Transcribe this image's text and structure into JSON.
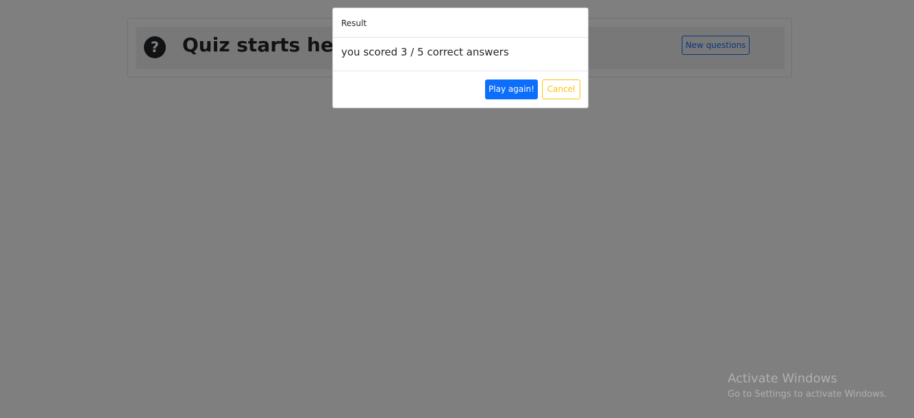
{
  "page": {
    "title": "Quiz starts here",
    "help_icon": "question-circle-icon",
    "help_symbol": "?",
    "new_questions_label": "New questions"
  },
  "modal": {
    "title": "Result",
    "message": "you scored 3 / 5 correct answers",
    "play_again_label": "Play again!",
    "cancel_label": "Cancel"
  },
  "watermark": {
    "title": "Activate Windows",
    "subtitle": "Go to Settings to activate Windows."
  },
  "colors": {
    "primary": "#0d6efd",
    "warning": "#ffc107",
    "dark": "#212529",
    "backdrop": "rgba(0,0,0,0.5)"
  }
}
